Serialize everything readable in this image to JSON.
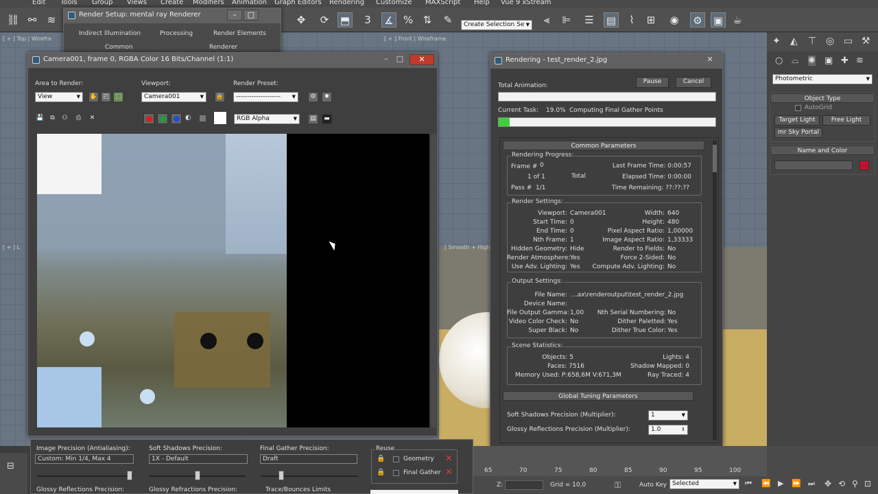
{
  "menubar": [
    "Edit",
    "Tools",
    "Group",
    "Views",
    "Create",
    "Modifiers",
    "Animation",
    "Graph Editors",
    "Rendering",
    "Customize",
    "MAXScript",
    "Help",
    "Vue 9 xStream"
  ],
  "toolbar": {
    "selection_set_placeholder": "Create Selection Se"
  },
  "viewports": {
    "top_label": "[ + ] Top | Wirefra",
    "front_label": "[ + ] Front | Wireframe",
    "left_label": "[ + ] L",
    "persp_label": "[ Smooth + High"
  },
  "command_panel": {
    "dropdown": "Photometric",
    "object_type_header": "Object Type",
    "autogrid": "AutoGrid",
    "buttons": [
      "Target Light",
      "Free Light",
      "mr Sky Portal"
    ],
    "name_color_header": "Name and Color",
    "swatch_color": "#c8102e"
  },
  "render_setup": {
    "title": "Render Setup: mental ray Renderer",
    "tabs_row1": [
      "Indirect Illumination",
      "Processing",
      "Render Elements"
    ],
    "tabs_row2": [
      "Common",
      "Renderer"
    ]
  },
  "frame_window": {
    "title": "Camera001, frame 0, RGBA Color 16 Bits/Channel (1:1)",
    "area_label": "Area to Render:",
    "area_value": "View",
    "viewport_label": "Viewport:",
    "viewport_value": "Camera001",
    "preset_label": "Render Preset:",
    "preset_value": "--------------------",
    "channel_value": "RGB Alpha",
    "dot_colors": [
      "#e21b1b",
      "#17a33a",
      "#1d4fd8"
    ]
  },
  "rendering_dialog": {
    "title": "Rendering - test_render_2.jpg",
    "pause": "Pause",
    "cancel": "Cancel",
    "total_animation": "Total Animation:",
    "current_task_label": "Current Task:",
    "current_task_pct": "19.0%",
    "current_task_text": "Computing Final Gather Points",
    "progress_fraction": 0.019,
    "common_params": "Common Parameters",
    "rendering_progress": {
      "caption": "Rendering Progress:",
      "frame_label": "Frame #",
      "frame": "0",
      "of": "1 of 1",
      "total": "Total",
      "pass_label": "Pass #",
      "pass": "1/1",
      "last_frame": "Last Frame Time: 0:00:57",
      "elapsed": "Elapsed Time: 0:00:00",
      "remaining": "Time Remaining: ??:??:??"
    },
    "render_settings": {
      "caption": "Render Settings:",
      "left": [
        [
          "Viewport:",
          "Camera001"
        ],
        [
          "Start Time:",
          "0"
        ],
        [
          "End Time:",
          "0"
        ],
        [
          "Nth Frame:",
          "1"
        ],
        [
          "Hidden Geometry:",
          "Hide"
        ],
        [
          "Render Atmosphere:",
          "Yes"
        ],
        [
          "Use Adv. Lighting:",
          "Yes"
        ]
      ],
      "right": [
        [
          "Width:",
          "640"
        ],
        [
          "Height:",
          "480"
        ],
        [
          "Pixel Aspect Ratio:",
          "1,00000"
        ],
        [
          "Image Aspect Ratio:",
          "1,33333"
        ],
        [
          "Render to Fields:",
          "No"
        ],
        [
          "Force 2-Sided:",
          "No"
        ],
        [
          "Compute Adv. Lighting:",
          "No"
        ]
      ]
    },
    "output_settings": {
      "caption": "Output Settings:",
      "file_name_label": "File Name:",
      "file_name": "...ax\\renderoutput\\test_render_2.jpg",
      "device_name_label": "Device Name:",
      "left": [
        [
          "File Output Gamma:",
          "1,00"
        ],
        [
          "Video Color Check:",
          "No"
        ],
        [
          "Super Black:",
          "No"
        ]
      ],
      "right": [
        [
          "Nth Serial Numbering:",
          "No"
        ],
        [
          "Dither Paletted:",
          "Yes"
        ],
        [
          "Dither True Color:",
          "Yes"
        ]
      ]
    },
    "scene_stats": {
      "caption": "Scene Statistics:",
      "objects": "Objects: 5",
      "faces": "Faces: 7516",
      "memory": "Memory Used: P:658,6M V:671,3M",
      "lights": "Lights: 4",
      "shadow_mapped": "Shadow Mapped: 0",
      "ray_traced": "Ray Traced: 4"
    },
    "global_tuning": "Global Tuning Parameters",
    "soft_shadows_label": "Soft Shadows Precision (Multiplier):",
    "soft_shadows_value": "1",
    "glossy_label": "Glossy Reflections Precision (Multiplier):",
    "glossy_value": "1.0"
  },
  "bottom_panel": {
    "image_precision_label": "Image Precision (Antialiasing):",
    "image_precision_value": "Custom: Min 1/4, Max 4",
    "soft_shadows_label": "Soft Shadows Precision:",
    "soft_shadows_value": "1X - Default",
    "final_gather_label": "Final Gather Precision:",
    "final_gather_value": "Draft",
    "reuse_label": "Reuse",
    "geometry": "Geometry",
    "final_gather": "Final Gather",
    "glossy_refl_label": "Glossy Reflections Precision:",
    "glossy_refr_label": "Glossy Refractions Precision:",
    "trace_label": "Trace/Bounces Limits"
  },
  "timeline": {
    "ticks": [
      "65",
      "70",
      "75",
      "80",
      "85",
      "90",
      "95",
      "100"
    ],
    "z_label": "Z:",
    "grid": "Grid = 10,0",
    "auto_key": "Auto Key",
    "selected": "Selected"
  }
}
